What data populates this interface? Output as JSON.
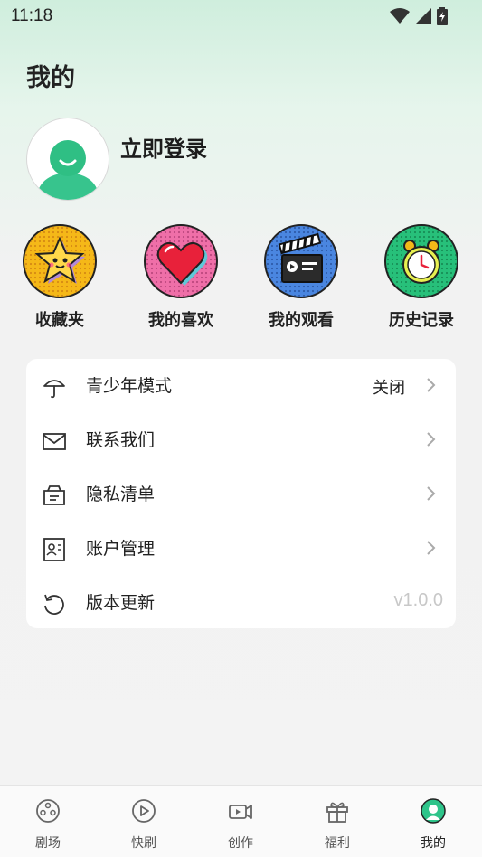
{
  "status_bar": {
    "time": "11:18"
  },
  "page": {
    "title": "我的"
  },
  "profile": {
    "login_label": "立即登录"
  },
  "shortcuts": [
    {
      "label": "收藏夹",
      "icon": "star-icon",
      "bg": "#f5b818"
    },
    {
      "label": "我的喜欢",
      "icon": "heart-icon",
      "bg": "#ef6fa8"
    },
    {
      "label": "我的观看",
      "icon": "clapperboard-icon",
      "bg": "#4a86e0"
    },
    {
      "label": "历史记录",
      "icon": "alarm-clock-icon",
      "bg": "#27c07a"
    }
  ],
  "menu": [
    {
      "label": "青少年模式",
      "value": "关闭",
      "icon": "umbrella-icon"
    },
    {
      "label": "联系我们",
      "icon": "mail-icon"
    },
    {
      "label": "隐私清单",
      "icon": "privacy-list-icon"
    },
    {
      "label": "账户管理",
      "icon": "id-card-icon"
    },
    {
      "label": "版本更新",
      "value": "v1.0.0",
      "icon": "refresh-icon"
    }
  ],
  "bottom_nav": [
    {
      "label": "剧场",
      "icon": "film-reel-icon"
    },
    {
      "label": "快刷",
      "icon": "play-circle-icon"
    },
    {
      "label": "创作",
      "icon": "video-camera-icon"
    },
    {
      "label": "福利",
      "icon": "gift-icon"
    },
    {
      "label": "我的",
      "icon": "profile-icon",
      "active": true
    }
  ],
  "colors": {
    "accent": "#2ec48a",
    "background": "#f3f3f3"
  }
}
